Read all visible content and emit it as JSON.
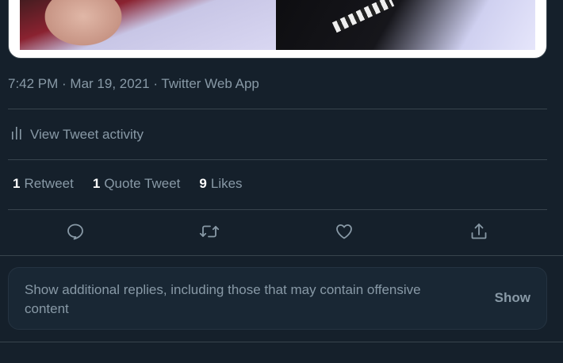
{
  "tweet": {
    "timestamp": "7:42 PM · Mar 19, 2021 · Twitter Web App",
    "activity_label": "View Tweet activity",
    "stats": {
      "retweets_count": "1",
      "retweets_label": "Retweet",
      "quotes_count": "1",
      "quotes_label": "Quote Tweet",
      "likes_count": "9",
      "likes_label": "Likes"
    }
  },
  "actions": {
    "icons": [
      "reply-icon",
      "retweet-icon",
      "like-icon",
      "share-icon"
    ]
  },
  "notice": {
    "text": "Show additional replies, including those that may contain offensive content",
    "button": "Show"
  },
  "colors": {
    "background": "#15202b",
    "secondary_text": "#8899a6",
    "border": "#38444d",
    "card": "#192734"
  }
}
